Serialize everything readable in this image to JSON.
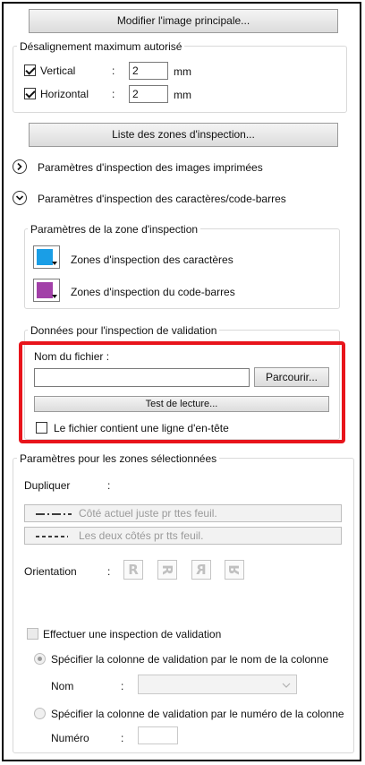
{
  "modify_main_image_button": "Modifier l'image principale...",
  "misalignment": {
    "title": "Désalignement maximum autorisé",
    "vertical": {
      "label": "Vertical",
      "colon": ":",
      "value": "2",
      "unit": "mm",
      "checked": true
    },
    "horizontal": {
      "label": "Horizontal",
      "colon": ":",
      "value": "2",
      "unit": "mm",
      "checked": true
    }
  },
  "inspection_zones_list_button": "Liste des zones d'inspection...",
  "printed_images_section": {
    "label": "Paramètres d'inspection des images imprimées",
    "expanded": false
  },
  "char_barcode_section": {
    "label": "Paramètres d'inspection des caractères/code-barres",
    "expanded": true
  },
  "zone_params": {
    "title": "Paramètres de la zone d'inspection",
    "char_zones": {
      "label": "Zones d'inspection des caractères",
      "color": "#1a9ee6"
    },
    "barcode_zones": {
      "label": "Zones d'inspection du code-barres",
      "color": "#a240a8"
    }
  },
  "validation_data": {
    "title": "Données pour l'inspection de validation",
    "filename_label": "Nom du fichier :",
    "filename_value": "",
    "browse_button": "Parcourir...",
    "read_test_button": "Test de lecture...",
    "header_checkbox_label": "Le fichier contient une ligne d'en-tête",
    "highlight_color": "#e8141b"
  },
  "selected_zones": {
    "title": "Paramètres pour les zones sélectionnées",
    "duplicate_label": "Dupliquer",
    "colon": ":",
    "current_side_button": "Côté actuel juste pr ttes feuil.",
    "both_sides_button": "Les deux côtés pr tts feuil.",
    "orientation_label": "Orientation",
    "orientation_glyph": "R",
    "validation_checkbox_label": "Effectuer une inspection de validation",
    "by_name_radio": "Spécifier la colonne de validation par le nom de la colonne",
    "name_label": "Nom",
    "by_number_radio": "Spécifier la colonne de validation par le numéro de la colonne",
    "number_label": "Numéro"
  }
}
